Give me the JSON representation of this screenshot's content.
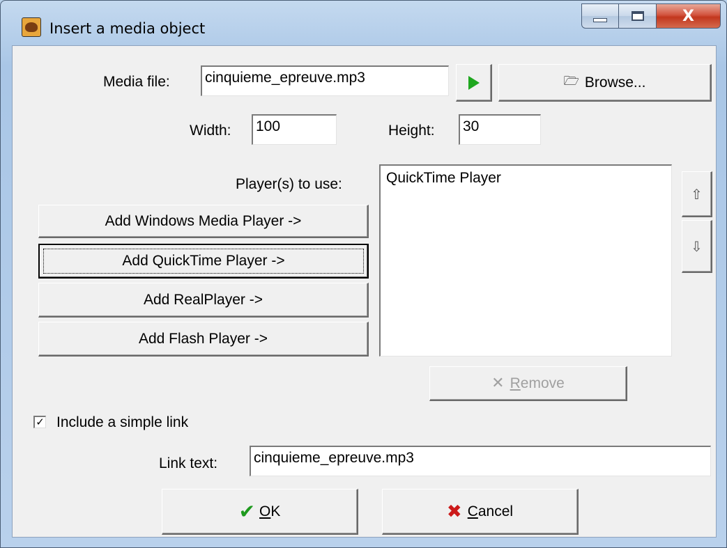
{
  "window": {
    "title": "Insert a media object",
    "close_glyph": "X"
  },
  "media_file": {
    "label": "Media file:",
    "value": "cinquieme_epreuve.mp3",
    "play_icon": "play-icon",
    "browse_label": "Browse...",
    "browse_icon": "folder-open-icon"
  },
  "size": {
    "width_label": "Width:",
    "width_value": "100",
    "height_label": "Height:",
    "height_value": "30"
  },
  "players": {
    "label": "Player(s) to use:",
    "buttons": [
      "Add Windows Media Player ->",
      "Add QuickTime Player ->",
      "Add RealPlayer ->",
      "Add Flash Player ->"
    ],
    "selected": [
      "QuickTime Player"
    ],
    "move_up_icon": "arrow-up-icon",
    "move_down_icon": "arrow-down-icon",
    "remove_label_first": "R",
    "remove_label_rest": "emove",
    "remove_icon": "x-icon"
  },
  "link": {
    "checkbox_label": "Include a simple link",
    "checked": true,
    "text_label": "Link text:",
    "text_value": "cinquieme_epreuve.mp3"
  },
  "footer": {
    "ok_first": "O",
    "ok_rest": "K",
    "cancel_first": "C",
    "cancel_rest": "ancel"
  },
  "colors": {
    "play_green": "#1fa71f",
    "ok_check_green": "#1e9a1e",
    "cancel_x_red": "#cc1a1a"
  }
}
